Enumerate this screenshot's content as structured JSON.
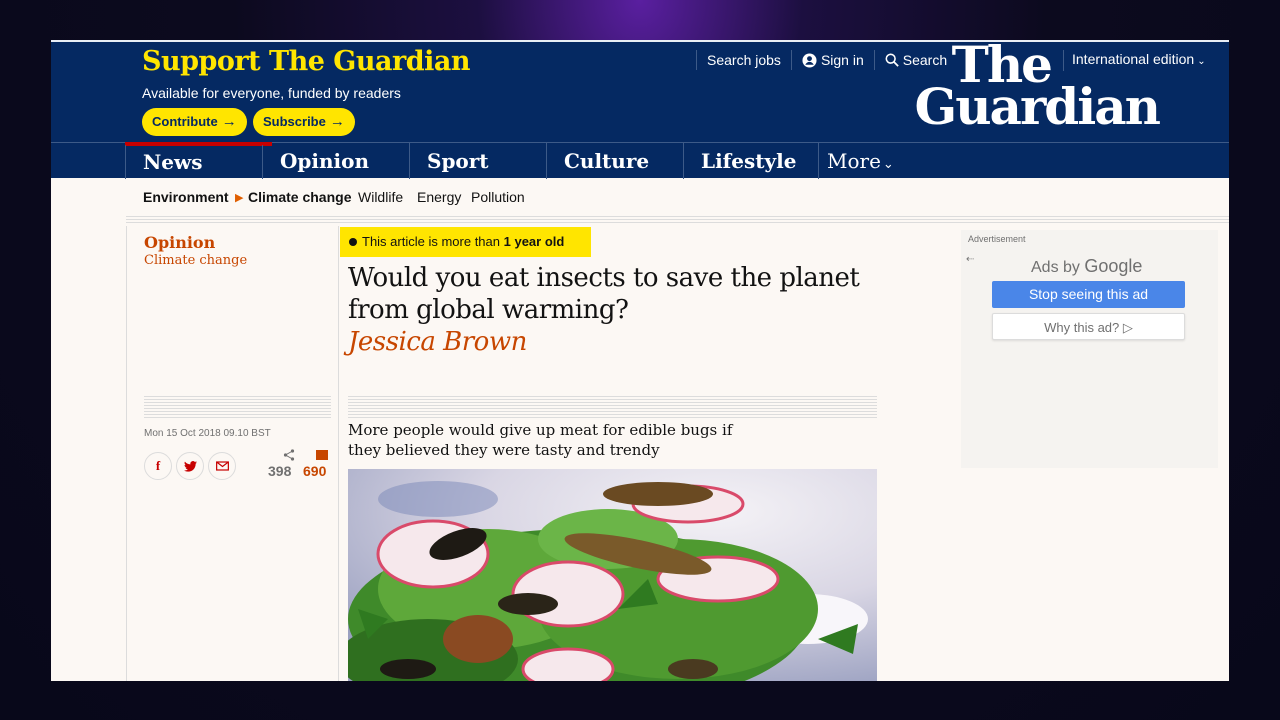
{
  "support": {
    "title": "Support The Guardian",
    "subtitle": "Available for everyone, funded by readers",
    "contribute_label": "Contribute",
    "subscribe_label": "Subscribe"
  },
  "top_links": {
    "search_jobs": "Search jobs",
    "sign_in": "Sign in",
    "search": "Search",
    "edition": "International edition"
  },
  "logo": {
    "line1": "The",
    "line2": "Guardian"
  },
  "nav": {
    "items": [
      {
        "label": "News"
      },
      {
        "label": "Opinion"
      },
      {
        "label": "Sport"
      },
      {
        "label": "Culture"
      },
      {
        "label": "Lifestyle"
      }
    ],
    "more_label": "More"
  },
  "subnav": {
    "section": "Environment",
    "current": "Climate change",
    "links": [
      "Wildlife",
      "Energy",
      "Pollution"
    ]
  },
  "article": {
    "pillar": "Opinion",
    "series": "Climate change",
    "age_badge_prefix": "This article is more than",
    "age_badge_bold": "1 year old",
    "headline": "Would you eat insects to save the planet from global warming?",
    "byline": "Jessica Brown",
    "standfirst": "More people would give up meat for edible bugs if they believed they were tasty and trendy",
    "published": "Mon 15 Oct 2018 09.10 BST",
    "share_count": "398",
    "comment_count": "690"
  },
  "ad": {
    "label": "Advertisement",
    "ads_by_prefix": "Ads by",
    "ads_by_brand": "Google",
    "stop_label": "Stop seeing this ad",
    "why_label": "Why this ad? ▷"
  },
  "colors": {
    "brand_blue": "#052962",
    "support_yellow": "#ffe500",
    "opinion_orange": "#c74600",
    "news_red": "#c70000"
  }
}
